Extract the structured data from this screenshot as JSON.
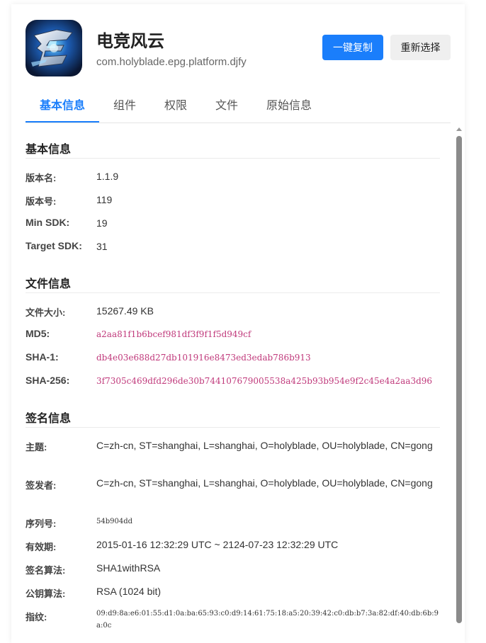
{
  "app": {
    "name": "电竞风云",
    "package": "com.holyblade.epg.platform.djfy",
    "icon": "app-logo-icon"
  },
  "actions": {
    "copy_label": "一键复制",
    "reselect_label": "重新选择"
  },
  "colors": {
    "accent": "#1a7efb",
    "hash_text": "#c0397b"
  },
  "tabs": [
    {
      "label": "基本信息",
      "active": true
    },
    {
      "label": "组件",
      "active": false
    },
    {
      "label": "权限",
      "active": false
    },
    {
      "label": "文件",
      "active": false
    },
    {
      "label": "原始信息",
      "active": false
    }
  ],
  "basic": {
    "title": "基本信息",
    "rows": [
      {
        "label": "版本名:",
        "value": "1.1.9"
      },
      {
        "label": "版本号:",
        "value": "119"
      },
      {
        "label": "Min SDK:",
        "value": "19"
      },
      {
        "label": "Target SDK:",
        "value": "31"
      }
    ]
  },
  "file": {
    "title": "文件信息",
    "rows": [
      {
        "label": "文件大小:",
        "value": "15267.49 KB"
      },
      {
        "label": "MD5:",
        "value": "a2aa81f1b6bcef981df3f9f1f5d949cf"
      },
      {
        "label": "SHA-1:",
        "value": "db4e03e688d27db101916e8473ed3edab786b913"
      },
      {
        "label": "SHA-256:",
        "value": "3f7305c469dfd296de30b744107679005538a425b93b954e9f2c45e4a2aa3d96"
      }
    ]
  },
  "signature": {
    "title": "签名信息",
    "rows": [
      {
        "label": "主题:",
        "value": "C=zh-cn, ST=shanghai, L=shanghai, O=holyblade, OU=holyblade, CN=gong"
      },
      {
        "label": "签发者:",
        "value": "C=zh-cn, ST=shanghai, L=shanghai, O=holyblade, OU=holyblade, CN=gong"
      },
      {
        "label": "序列号:",
        "value": "54b904dd"
      },
      {
        "label": "有效期:",
        "value": "2015-01-16 12:32:29 UTC ~ 2124-07-23 12:32:29 UTC"
      },
      {
        "label": "签名算法:",
        "value": "SHA1withRSA"
      },
      {
        "label": "公钥算法:",
        "value": "RSA (1024 bit)"
      },
      {
        "label": "指纹:",
        "value": "09:d9:8a:e6:01:55:d1:0a:ba:65:93:c0:d9:14:61:75:18:a5:20:39:42:c0:db:b7:3a:82:df:40:db:6b:9a:0c"
      }
    ]
  }
}
